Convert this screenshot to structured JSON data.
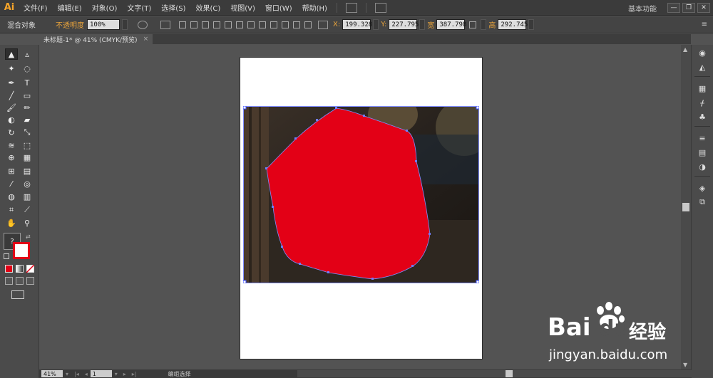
{
  "app": {
    "logo": "Ai"
  },
  "menu": {
    "items": [
      "文件(F)",
      "编辑(E)",
      "对象(O)",
      "文字(T)",
      "选择(S)",
      "效果(C)",
      "视图(V)",
      "窗口(W)",
      "帮助(H)"
    ],
    "workspace": "基本功能",
    "window_buttons": [
      "—",
      "❐",
      "✕"
    ]
  },
  "control": {
    "object_label": "混合对象",
    "opacity_label": "不透明度",
    "opacity_value": "100%",
    "x_label": "X:",
    "x_value": "199.328",
    "y_label": "Y:",
    "y_value": "227.795",
    "w_label": "宽",
    "w_value": "387.798",
    "h_label": "高",
    "h_value": "292.745"
  },
  "document": {
    "tab_title": "未标题-1* @ 41% (CMYK/预览)",
    "tab_close": "×"
  },
  "status": {
    "zoom": "41%",
    "page": "1",
    "mode": "编组选择"
  },
  "toolbar": {
    "fill_unknown": "?"
  },
  "watermark": {
    "brand": "Bai",
    "brand2": "du",
    "cn": "经验",
    "url": "jingyan.baidu.com"
  },
  "colors": {
    "fill_red": "#e30016",
    "accent_orange": "#e8a33b",
    "ui_dark": "#535353"
  }
}
